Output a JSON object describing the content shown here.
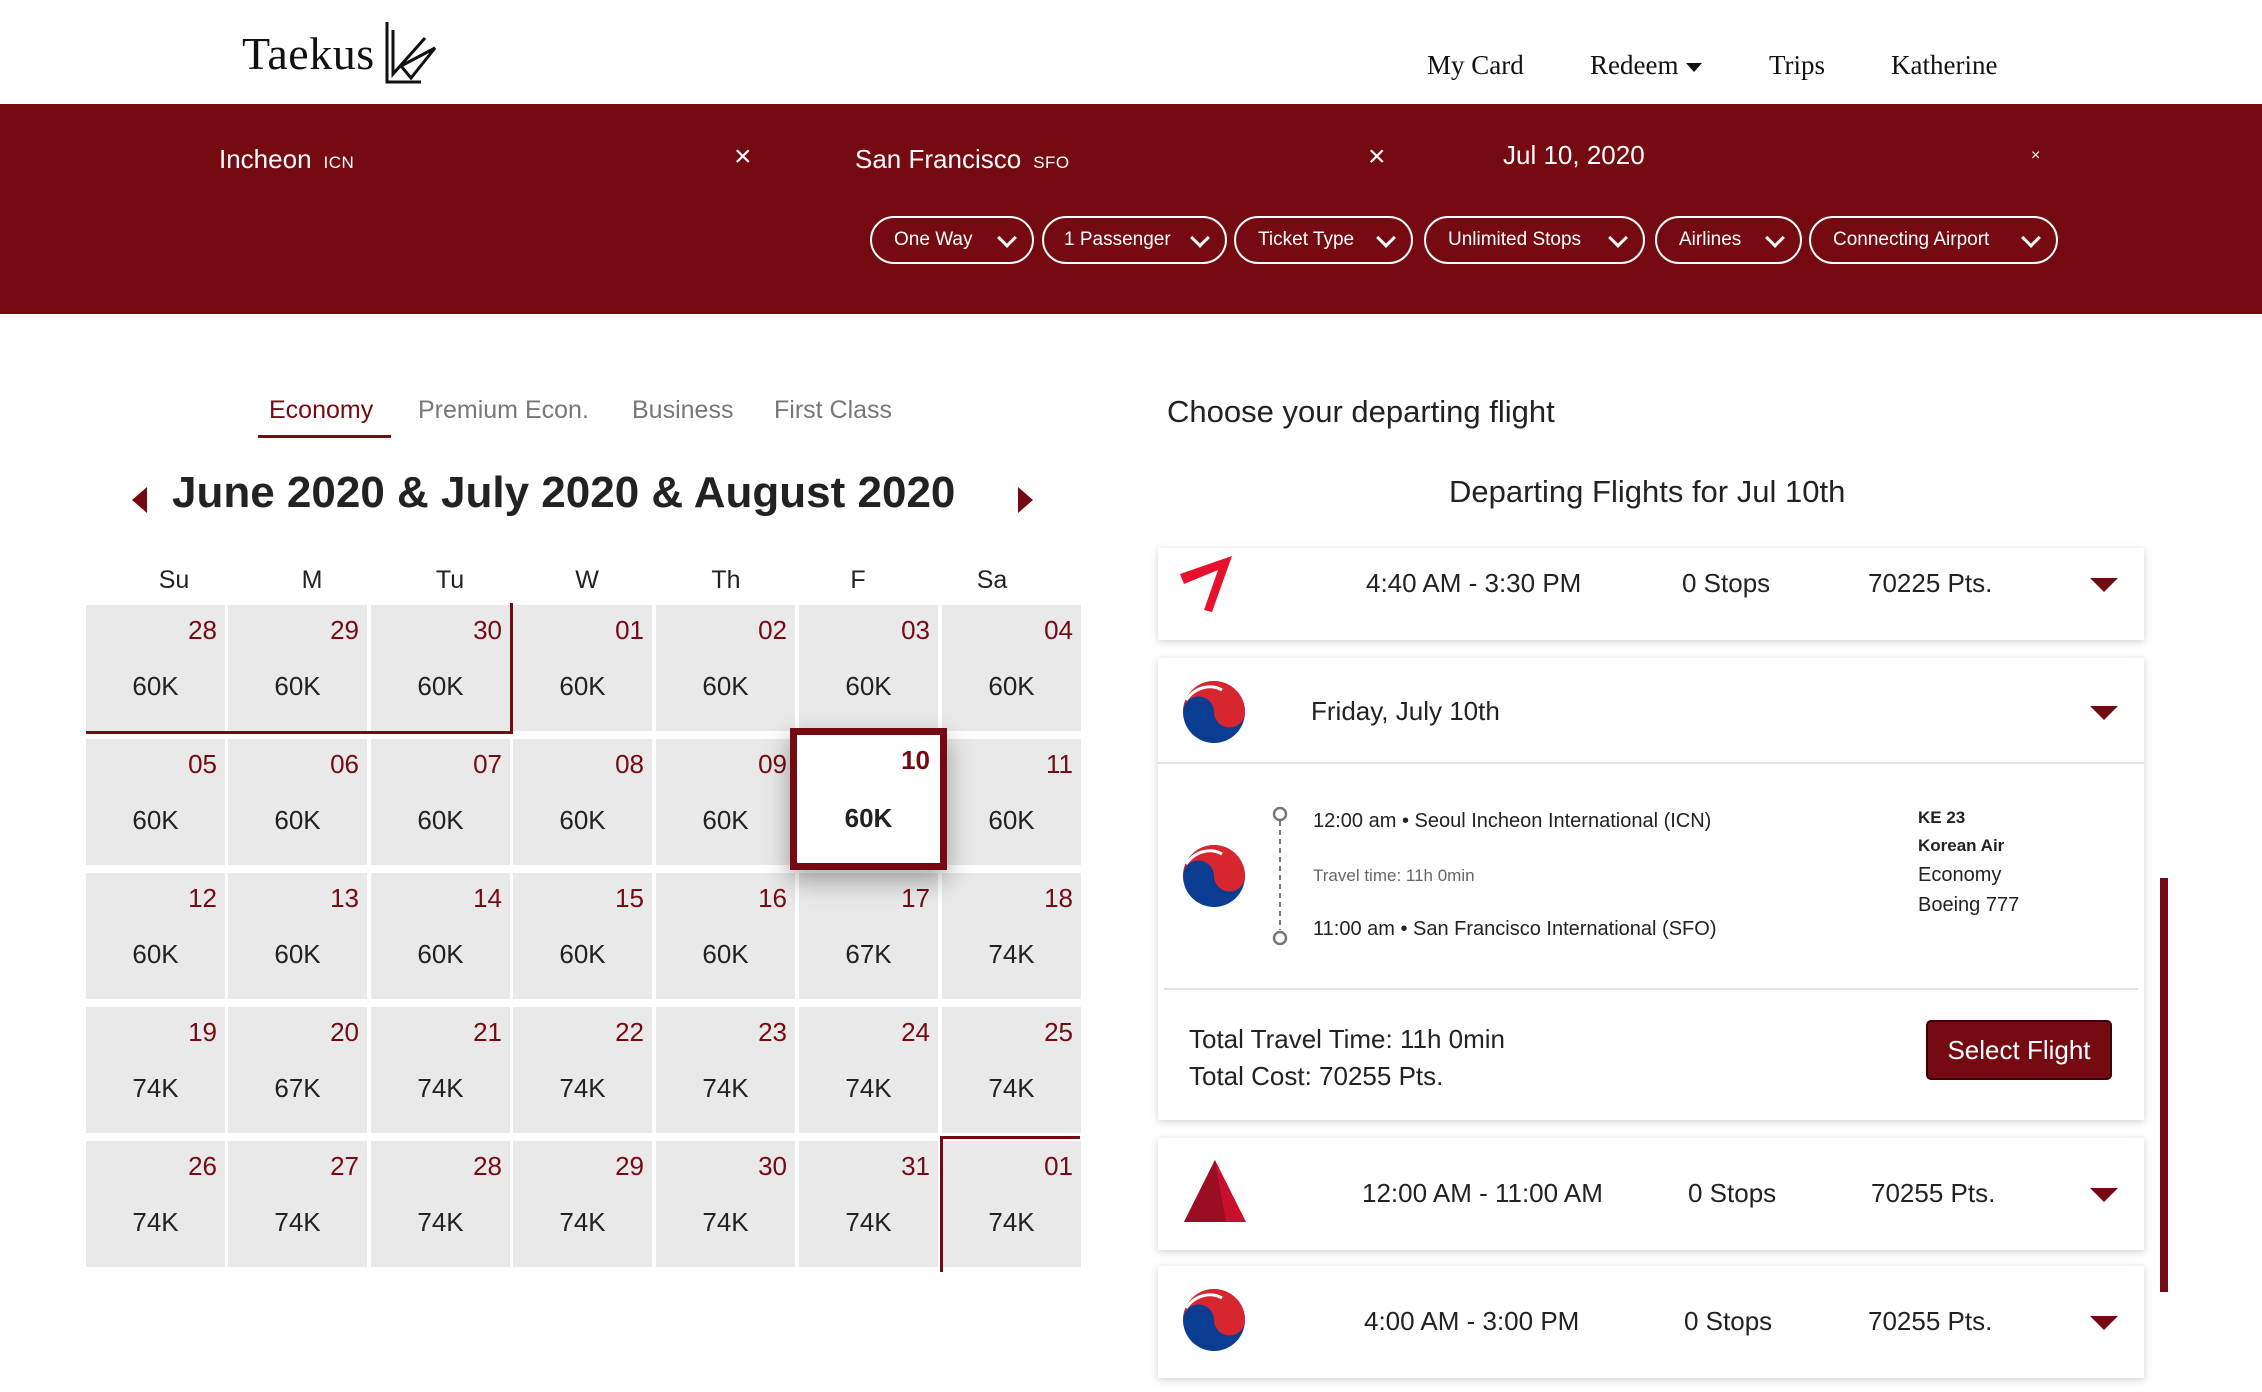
{
  "header": {
    "logo_text": "Taekus",
    "nav": {
      "my_card": "My Card",
      "redeem": "Redeem",
      "trips": "Trips",
      "user": "Katherine"
    }
  },
  "search": {
    "origin": {
      "city": "Incheon",
      "code": "ICN"
    },
    "destination": {
      "city": "San Francisco",
      "code": "SFO"
    },
    "date": "Jul 10, 2020",
    "clear_symbol": "×",
    "filters": [
      "One Way",
      "1 Passenger",
      "Ticket Type",
      "Unlimited Stops",
      "Airlines",
      "Connecting Airport"
    ]
  },
  "cabins": {
    "economy": "Economy",
    "premium": "Premium Econ.",
    "business": "Business",
    "first": "First Class"
  },
  "calendar": {
    "title": "June 2020 & July 2020 & August 2020",
    "weekdays": [
      "Su",
      "M",
      "Tu",
      "W",
      "Th",
      "F",
      "Sa"
    ],
    "weeks": [
      [
        {
          "day": "28",
          "price": "60K"
        },
        {
          "day": "29",
          "price": "60K"
        },
        {
          "day": "30",
          "price": "60K"
        },
        {
          "day": "01",
          "price": "60K"
        },
        {
          "day": "02",
          "price": "60K"
        },
        {
          "day": "03",
          "price": "60K"
        },
        {
          "day": "04",
          "price": "60K"
        }
      ],
      [
        {
          "day": "05",
          "price": "60K"
        },
        {
          "day": "06",
          "price": "60K"
        },
        {
          "day": "07",
          "price": "60K"
        },
        {
          "day": "08",
          "price": "60K"
        },
        {
          "day": "09",
          "price": "60K"
        },
        {
          "day": "10",
          "price": "60K"
        },
        {
          "day": "11",
          "price": "60K"
        }
      ],
      [
        {
          "day": "12",
          "price": "60K"
        },
        {
          "day": "13",
          "price": "60K"
        },
        {
          "day": "14",
          "price": "60K"
        },
        {
          "day": "15",
          "price": "60K"
        },
        {
          "day": "16",
          "price": "60K"
        },
        {
          "day": "17",
          "price": "67K"
        },
        {
          "day": "18",
          "price": "74K"
        }
      ],
      [
        {
          "day": "19",
          "price": "74K"
        },
        {
          "day": "20",
          "price": "67K"
        },
        {
          "day": "21",
          "price": "74K"
        },
        {
          "day": "22",
          "price": "74K"
        },
        {
          "day": "23",
          "price": "74K"
        },
        {
          "day": "24",
          "price": "74K"
        },
        {
          "day": "25",
          "price": "74K"
        }
      ],
      [
        {
          "day": "26",
          "price": "74K"
        },
        {
          "day": "27",
          "price": "74K"
        },
        {
          "day": "28",
          "price": "74K"
        },
        {
          "day": "29",
          "price": "74K"
        },
        {
          "day": "30",
          "price": "74K"
        },
        {
          "day": "31",
          "price": "74K"
        },
        {
          "day": "01",
          "price": "74K"
        }
      ]
    ]
  },
  "results": {
    "choose_title": "Choose your departing flight",
    "departing_title": "Departing Flights for Jul 10th",
    "flights": [
      {
        "times": "4:40 AM - 3:30 PM",
        "stops": "0 Stops",
        "points": "70225 Pts."
      },
      {
        "times": "12:00 AM - 11:00 AM",
        "stops": "0 Stops",
        "points": "70255 Pts."
      },
      {
        "times": "4:00 AM - 3:00 PM",
        "stops": "0 Stops",
        "points": "70255 Pts."
      }
    ],
    "expanded": {
      "date": "Friday, July 10th",
      "depart": "12:00 am • Seoul Incheon International (ICN)",
      "travel_time": "Travel time: 11h 0min",
      "arrive": "11:00 am • San Francisco International (SFO)",
      "flight_no": "KE 23",
      "airline": "Korean Air",
      "cabin": "Economy",
      "aircraft": "Boeing 777",
      "total_time": "Total Travel Time: 11h 0min",
      "total_cost": "Total Cost: 70255 Pts.",
      "select_label": "Select Flight"
    }
  },
  "colors": {
    "brand": "#750a12",
    "cell_bg": "#e9e9e9"
  }
}
